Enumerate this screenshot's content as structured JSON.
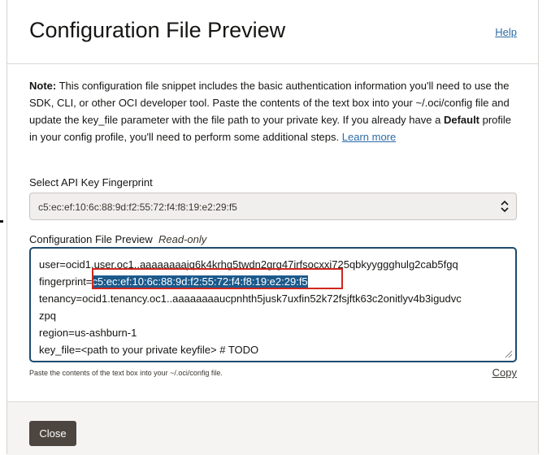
{
  "dialog": {
    "title": "Configuration File Preview",
    "help_link": "Help"
  },
  "note": {
    "bold_prefix": "Note:",
    "text_1": " This configuration file snippet includes the basic authentication information you'll need to use the SDK, CLI, or other OCI developer tool. Paste the contents of the text box into your ~/.oci/config file and update the key_file parameter with the file path to your private key. If you already have a ",
    "bold_default": "Default",
    "text_2": " profile in your config profile, you'll need to perform some additional steps. ",
    "learn_more": "Learn more"
  },
  "fingerprint_select": {
    "label": "Select API Key Fingerprint",
    "value": "c5:ec:ef:10:6c:88:9d:f2:55:72:f4:f8:19:e2:29:f5"
  },
  "preview": {
    "label": "Configuration File Preview",
    "readonly": "Read-only",
    "line_user": "user=ocid1.user.oc1..aaaaaaaajq6k4krhg5twdn2grg47irfsocxxi725qbkyyggghulg2cab5fgq",
    "line_fingerprint_key": "fingerprint=",
    "line_fingerprint_val": "c5:ec:ef:10:6c:88:9d:f2:55:72:f4:f8:19:e2:29:f5",
    "line_tenancy": "tenancy=ocid1.tenancy.oc1..aaaaaaaaucpnhth5jusk7uxfin52k72fsjftk63c2onitlyv4b3igudvc",
    "line_tenancy_wrap": "zpq",
    "line_region": "region=us-ashburn-1",
    "line_keyfile": "key_file=<path to your private keyfile> # TODO"
  },
  "hint": "Paste the contents of the text box into your ~/.oci/config file.",
  "copy_link": "Copy",
  "footer": {
    "close_label": "Close"
  },
  "colors": {
    "accent_link": "#2c6ba8",
    "focus_border": "#1f4a6e",
    "highlight": "#1b5a8c",
    "annotation_red": "#d0261d",
    "button_bg": "#4d4540"
  }
}
